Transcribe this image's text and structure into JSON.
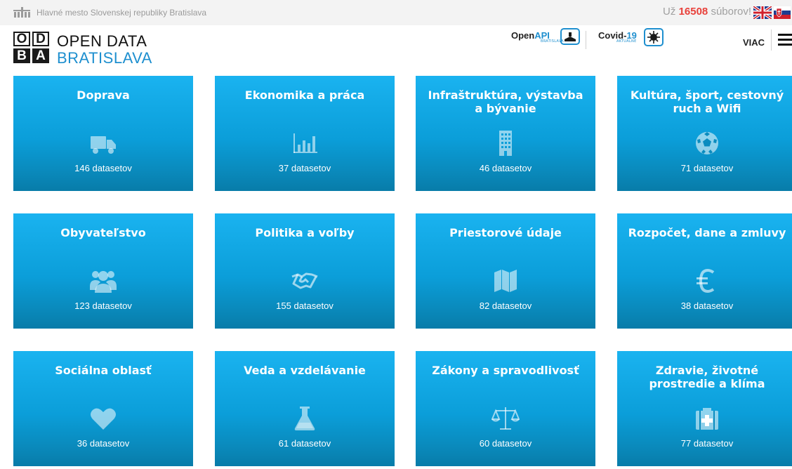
{
  "topbar": {
    "city_text": "Hlavné mesto Slovenskej republiky Bratislava",
    "files_prefix": "Už",
    "files_count": "16508",
    "files_suffix": "súborov!"
  },
  "header": {
    "logo_letters": [
      "O",
      "D",
      "B",
      "A"
    ],
    "title_line1": "OPEN DATA",
    "title_line2": "BRATISLAVA",
    "openapi_main": "Open",
    "openapi_accent": "API",
    "openapi_sub": "BRATISLAVA",
    "covid_main": "Covid-",
    "covid_accent": "19",
    "covid_sub": "AKTUÁLNE",
    "more_label": "VIAC"
  },
  "colors": {
    "tile_top": "#1ab3f0",
    "tile_bottom": "#087ca9",
    "brand_blue": "#1e8fcf",
    "count_red": "#e8413b"
  },
  "categories": [
    {
      "title": "Doprava",
      "count": "146 datasetov",
      "icon": "truck-icon"
    },
    {
      "title": "Ekonomika a práca",
      "count": "37 datasetov",
      "icon": "bar-chart-icon"
    },
    {
      "title": "Infraštruktúra, výstavba a bývanie",
      "count": "46 datasetov",
      "icon": "building-icon"
    },
    {
      "title": "Kultúra, šport, cestovný ruch a Wifi",
      "count": "71 datasetov",
      "icon": "soccer-ball-icon"
    },
    {
      "title": "Obyvateľstvo",
      "count": "123 datasetov",
      "icon": "users-icon"
    },
    {
      "title": "Politika a voľby",
      "count": "155 datasetov",
      "icon": "handshake-icon"
    },
    {
      "title": "Priestorové údaje",
      "count": "82 datasetov",
      "icon": "map-icon"
    },
    {
      "title": "Rozpočet, dane a zmluvy",
      "count": "38 datasetov",
      "icon": "euro-icon"
    },
    {
      "title": "Sociálna oblasť",
      "count": "36 datasetov",
      "icon": "heart-icon"
    },
    {
      "title": "Veda a vzdelávanie",
      "count": "61 datasetov",
      "icon": "flask-icon"
    },
    {
      "title": "Zákony a spravodlivosť",
      "count": "60 datasetov",
      "icon": "scales-icon"
    },
    {
      "title": "Zdravie, životné prostredie a klíma",
      "count": "77 datasetov",
      "icon": "medkit-icon"
    }
  ]
}
